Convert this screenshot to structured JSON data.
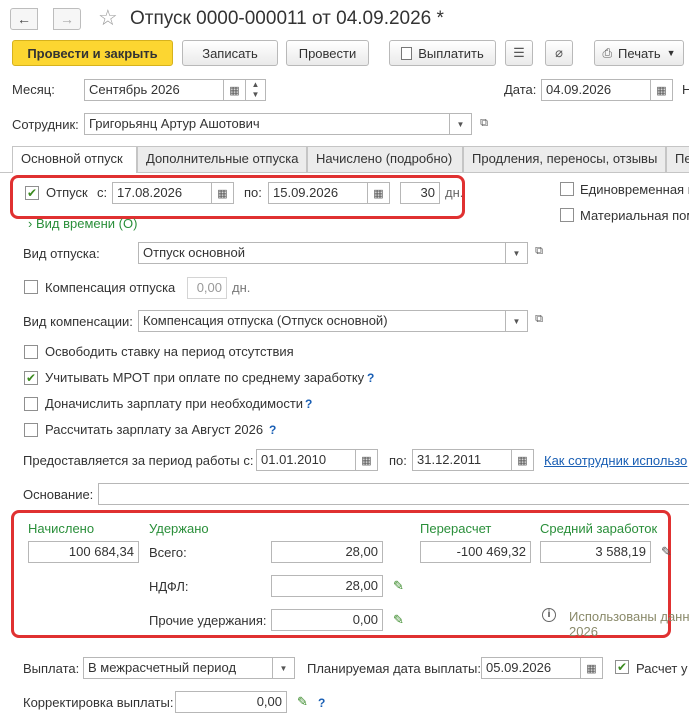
{
  "title": "Отпуск 0000-000011 от 04.09.2026 *",
  "toolbar": {
    "post_close": "Провести и закрыть",
    "save": "Записать",
    "post": "Провести",
    "pay": "Выплатить",
    "print": "Печать"
  },
  "header": {
    "month_label": "Месяц:",
    "month_value": "Сентябрь 2026",
    "date_label": "Дата:",
    "date_value": "04.09.2026",
    "date_tail": "Н",
    "employee_label": "Сотрудник:",
    "employee_value": "Григорьянц Артур Ашотович"
  },
  "tabs": [
    "Основной отпуск",
    "Дополнительные отпуска",
    "Начислено (подробно)",
    "Продления, переносы, отзывы",
    "Пе"
  ],
  "leave": {
    "label": "Отпуск",
    "from_label": "с:",
    "from_value": "17.08.2026",
    "to_label": "по:",
    "to_value": "15.09.2026",
    "days_value": "30",
    "days_unit": "дн.",
    "time_kind_link": "Вид времени (О)",
    "one_time_label": "Единовременная п",
    "material_label": "Материальная пом"
  },
  "leave_kind": {
    "label": "Вид отпуска:",
    "value": "Отпуск основной"
  },
  "compensation": {
    "label": "Компенсация отпуска",
    "days_value": "0,00",
    "days_unit": "дн."
  },
  "compensation_kind": {
    "label": "Вид компенсации:",
    "value": "Компенсация отпуска (Отпуск основной)"
  },
  "options": {
    "release_rate": "Освободить ставку на период отсутствия",
    "consider_mrot": "Учитывать МРОТ при оплате по среднему заработку",
    "extra_salary": "Доначислить зарплату при необходимости",
    "calc_salary": "Рассчитать зарплату за Август 2026",
    "q": "?"
  },
  "work_period": {
    "label": "Предоставляется за период работы с:",
    "from_value": "01.01.2010",
    "to_label": "по:",
    "to_value": "31.12.2011",
    "link": "Как сотрудник использо"
  },
  "basis": {
    "label": "Основание:",
    "value": ""
  },
  "totals": {
    "accrued_label": "Начислено",
    "accrued_value": "100 684,34",
    "withheld_label": "Удержано",
    "total_label": "Всего:",
    "total_value": "28,00",
    "ndfl_label": "НДФЛ:",
    "ndfl_value": "28,00",
    "other_label": "Прочие удержания:",
    "other_value": "0,00",
    "recalc_label": "Перерасчет",
    "recalc_value": "-100 469,32",
    "avg_label": "Средний заработок",
    "avg_value": "3 588,19",
    "used_data_text_1": "Использованы данн",
    "used_data_text_2": "2026"
  },
  "payment": {
    "label": "Выплата:",
    "value": "В межрасчетный период",
    "planned_label": "Планируемая дата выплаты:",
    "planned_value": "05.09.2026",
    "calc_label": "Расчет у",
    "adjust_label": "Корректировка выплаты:",
    "adjust_value": "0,00"
  }
}
